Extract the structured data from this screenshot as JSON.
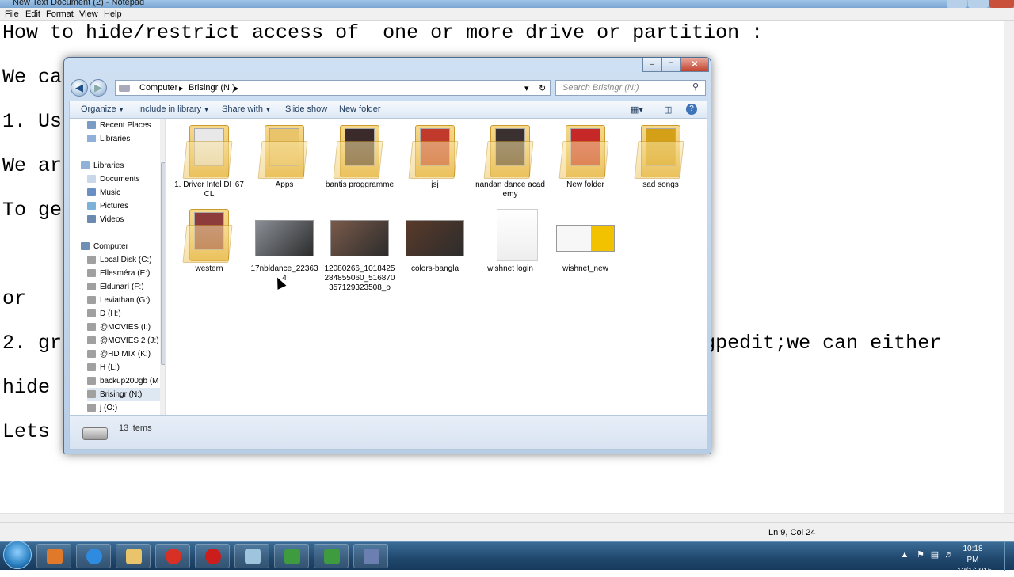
{
  "notepad": {
    "title": "New Text Document (2) - Notepad",
    "menu": [
      "File",
      "Edit",
      "Format",
      "View",
      "Help"
    ],
    "lines": [
      "How to hide/restrict access of  one or more drive or partition :",
      "We ca",
      "1. Us",
      "We ar",
      "To ge",
      "",
      "or",
      "2. gr                                                      gpedit;we can either",
      "hide",
      "Lets"
    ],
    "status": "Ln 9, Col 24"
  },
  "explorer": {
    "window_buttons": {
      "minimize": "–",
      "maximize": "□",
      "close": "✕"
    },
    "breadcrumb": [
      "Computer",
      "Brisingr (N:)"
    ],
    "search_placeholder": "Search Brisingr (N:)",
    "toolbar": [
      "Organize",
      "Include in library",
      "Share with",
      "Slide show",
      "New folder"
    ],
    "nav_items": [
      {
        "label": "Recent Places",
        "color": "#7a9bc4"
      },
      {
        "label": "Libraries",
        "color": "#8fb0d8"
      },
      {
        "label": "Libraries",
        "color": "#8fb0d8"
      },
      {
        "label": "Documents",
        "color": "#c9d7e8"
      },
      {
        "label": "Music",
        "color": "#6a8fc2"
      },
      {
        "label": "Pictures",
        "color": "#7cb2d9"
      },
      {
        "label": "Videos",
        "color": "#6c8ab0"
      },
      {
        "label": "Computer",
        "color": "#6f8fb4"
      },
      {
        "label": "Local Disk (C:)",
        "color": "#a0a0a0"
      },
      {
        "label": "Ellesméra (E:)",
        "color": "#a0a0a0"
      },
      {
        "label": "Eldunarí (F:)",
        "color": "#a0a0a0"
      },
      {
        "label": "Leviathan (G:)",
        "color": "#a0a0a0"
      },
      {
        "label": "D (H:)",
        "color": "#a0a0a0"
      },
      {
        "label": "@MOVIES (I:)",
        "color": "#a0a0a0"
      },
      {
        "label": "@MOVIES 2 (J:)",
        "color": "#a0a0a0"
      },
      {
        "label": "@HD MIX (K:)",
        "color": "#a0a0a0"
      },
      {
        "label": "H (L:)",
        "color": "#a0a0a0"
      },
      {
        "label": "backup200gb (M",
        "color": "#a0a0a0"
      },
      {
        "label": "Brisingr (N:)",
        "color": "#a0a0a0"
      },
      {
        "label": "j (O:)",
        "color": "#a0a0a0"
      }
    ],
    "items": [
      {
        "label": "1. Driver Intel DH67CL",
        "kind": "folder",
        "accent": "#e8e8e8"
      },
      {
        "label": "Apps",
        "kind": "folder",
        "accent": "#e9c46a"
      },
      {
        "label": "bantis proggramme",
        "kind": "folder",
        "accent": "#3a2a2a"
      },
      {
        "label": "jsj",
        "kind": "folder",
        "accent": "#c0392b"
      },
      {
        "label": "nandan dance academy",
        "kind": "folder",
        "accent": "#3b3030"
      },
      {
        "label": "New folder",
        "kind": "folder",
        "accent": "#c62828"
      },
      {
        "label": "sad songs",
        "kind": "folder",
        "accent": "#d4a017"
      },
      {
        "label": "western",
        "kind": "folder",
        "accent": "#8e3b3b"
      },
      {
        "label": "17nbldance_223634",
        "kind": "photo",
        "accent": "#8a8f96"
      },
      {
        "label": "12080266_1018425284855060_516870357129323508_o",
        "kind": "photo",
        "accent": "#7a5a4a"
      },
      {
        "label": "colors-bangla",
        "kind": "photo",
        "accent": "#5a3a2a"
      },
      {
        "label": "wishnet login",
        "kind": "doc",
        "accent": "#ffffff"
      },
      {
        "label": "wishnet_new",
        "kind": "image",
        "accent": "#f2c200"
      }
    ],
    "details": "13 items"
  },
  "taskbar": {
    "time": "10:18 PM",
    "date": "12/1/2015",
    "buttons": [
      {
        "name": "media-player-icon",
        "color": "#e07a2a"
      },
      {
        "name": "internet-explorer-icon",
        "color": "#2f8be0"
      },
      {
        "name": "explorer-icon",
        "color": "#e9c46a"
      },
      {
        "name": "chrome-icon",
        "color": "#d93025"
      },
      {
        "name": "opera-icon",
        "color": "#cc1d1d"
      },
      {
        "name": "notepad-icon",
        "color": "#9fc4dd"
      },
      {
        "name": "camtasia-icon",
        "color": "#3f9b3f"
      },
      {
        "name": "camtasia-recorder-icon",
        "color": "#3f9b3f"
      },
      {
        "name": "network-tool-icon",
        "color": "#6b7fb0"
      }
    ]
  }
}
